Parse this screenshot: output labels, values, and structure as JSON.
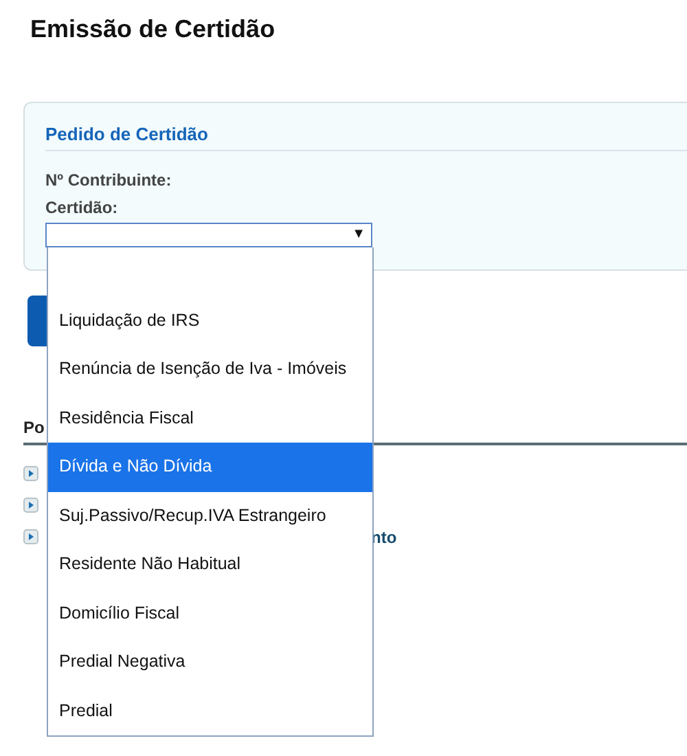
{
  "page_title": "Emissão de Certidão",
  "panel": {
    "title": "Pedido de Certidão",
    "labels": [
      "Nº Contribuinte:",
      "Certidão:"
    ],
    "select": {
      "arrow": "▼",
      "expanded": true,
      "options": [
        {
          "selected": false
        },
        {
          "label": "Liquidação de IRS",
          "selected": false
        },
        {
          "label": "Renúncia de Isenção de Iva - Imóveis",
          "selected": false
        },
        {
          "label": "Residência Fiscal",
          "selected": false
        },
        {
          "label": "Dívida e Não Dívida",
          "selected": true
        },
        {
          "label": "Suj.Passivo/Recup.IVA Estrangeiro",
          "selected": false
        },
        {
          "label": "Residente Não Habitual",
          "selected": false
        },
        {
          "label": "Domicílio Fiscal",
          "selected": false
        },
        {
          "label": "Predial Negativa",
          "selected": false
        },
        {
          "label": "Predial",
          "selected": false
        }
      ]
    }
  },
  "section": {
    "heading": "Po",
    "links": [
      {
        "kind": "covered"
      },
      {
        "kind": "covered"
      },
      {
        "kind": "partly_covered",
        "text": "nto"
      }
    ]
  }
}
